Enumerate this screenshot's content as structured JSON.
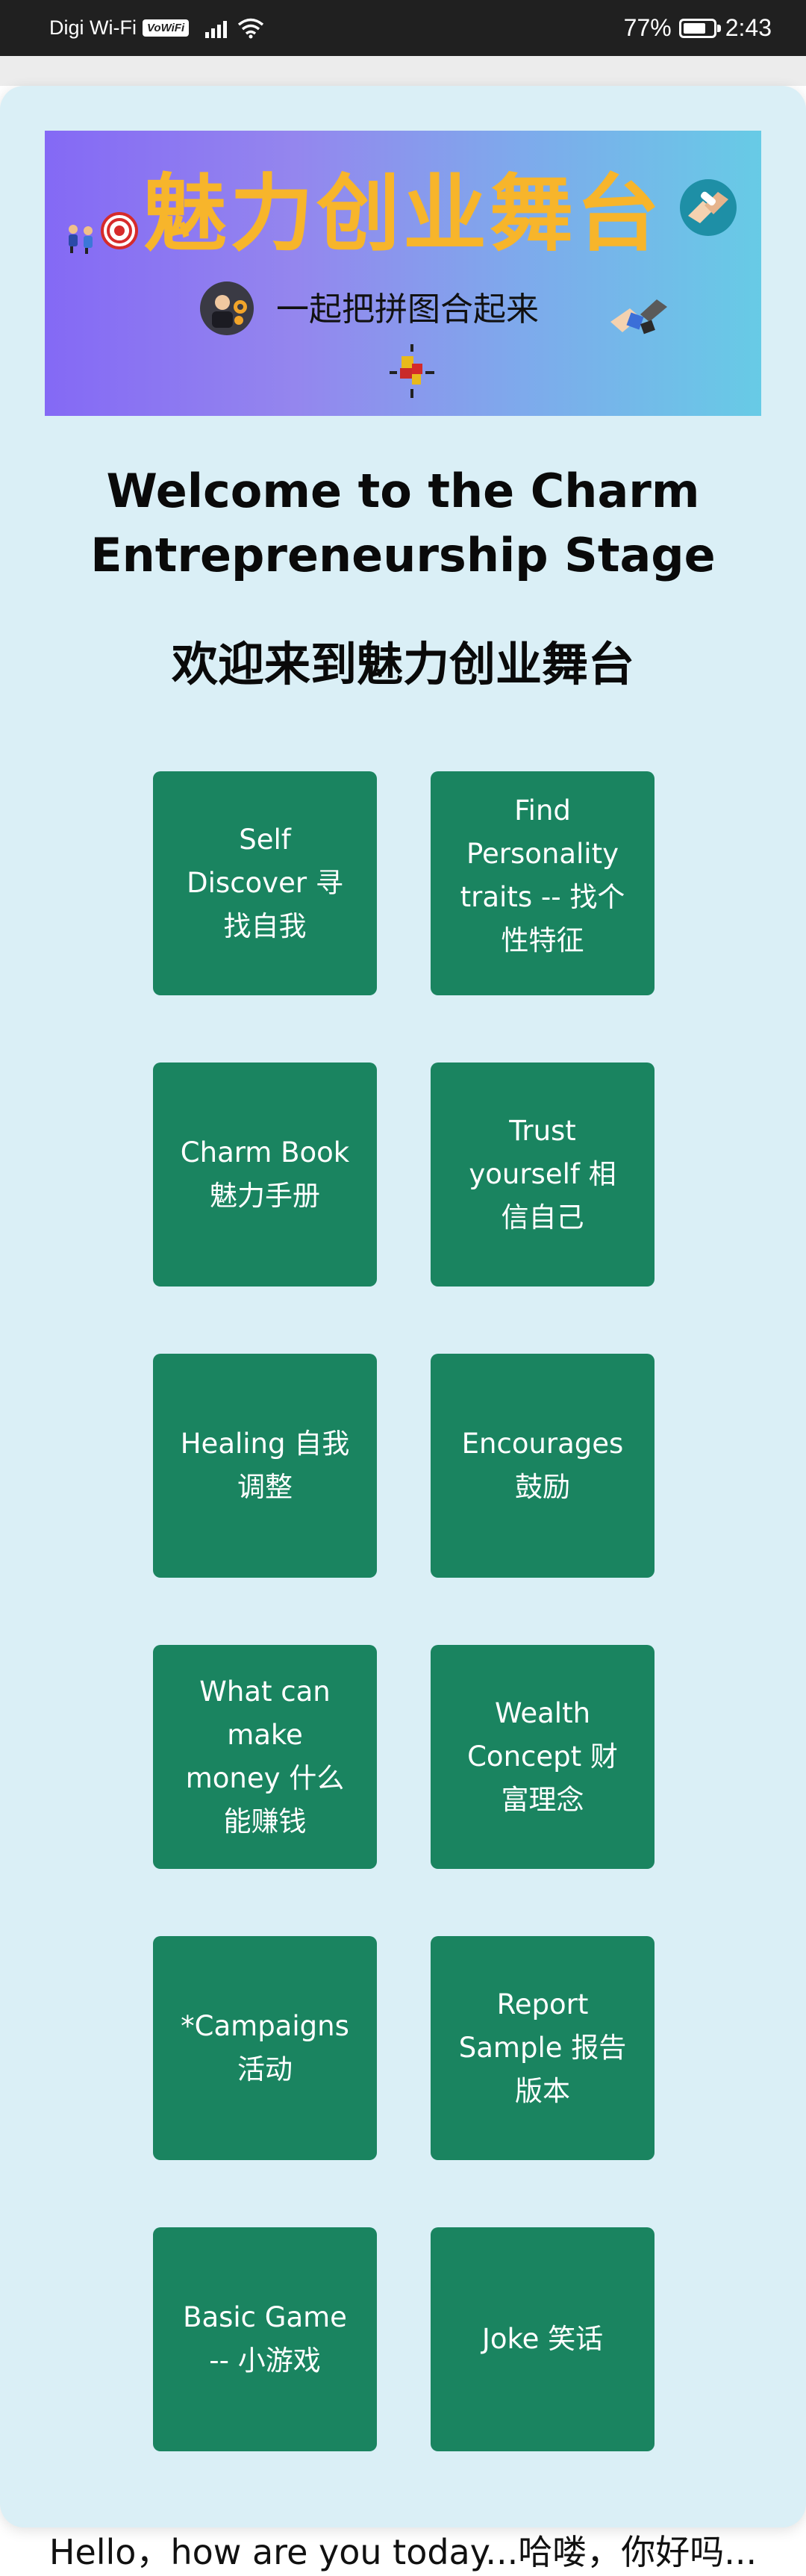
{
  "status_bar": {
    "carrier": "Digi Wi-Fi",
    "vowifi_badge": "VoWiFi",
    "battery_percent": "77%",
    "battery_level": 0.77,
    "time": "2:43"
  },
  "banner": {
    "title": "魅力创业舞台",
    "subtitle": "一起把拼图合起来",
    "colors": {
      "title": "#f7b52b",
      "gradient_start": "#8469f5",
      "gradient_end": "#67cbe6"
    }
  },
  "headings": {
    "welcome_en": "Welcome to the Charm Entrepreneurship Stage",
    "welcome_cn": "欢迎来到魅力创业舞台"
  },
  "tiles": [
    {
      "label": "Self Discover 寻找自我"
    },
    {
      "label": "Find Personality traits -- 找个性特征"
    },
    {
      "label": "Charm Book 魅力手册"
    },
    {
      "label": "Trust yourself 相信自己"
    },
    {
      "label": "Healing 自我调整"
    },
    {
      "label": "Encourages 鼓励"
    },
    {
      "label": "What can make money 什么能赚钱"
    },
    {
      "label": "Wealth Concept 财富理念"
    },
    {
      "label": "*Campaigns 活动"
    },
    {
      "label": "Report Sample 报告版本"
    },
    {
      "label": "Basic Game -- 小游戏"
    },
    {
      "label": "Joke 笑话"
    }
  ],
  "tile_color": "#1a8460",
  "footer": {
    "greeting": "Hello，how are you today...哈喽，你好吗..."
  }
}
